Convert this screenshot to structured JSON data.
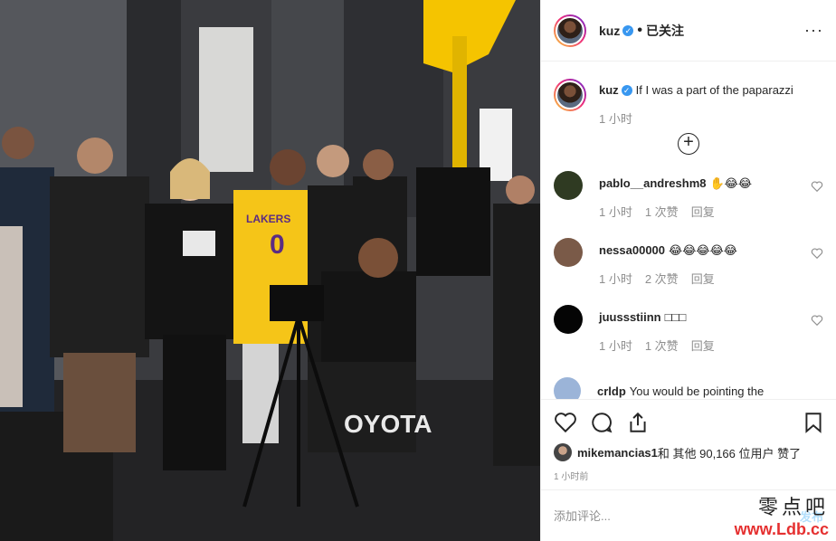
{
  "header": {
    "username": "kuz",
    "separator": "•",
    "follow_state": "已关注",
    "more": "···"
  },
  "caption": {
    "username": "kuz",
    "text": "If I was a part of the paparazzi",
    "time": "1 小时"
  },
  "comments": [
    {
      "username": "pablo__andreshm8",
      "text": "✋😂😂",
      "time": "1 小时",
      "likes": "1 次赞",
      "reply": "回复",
      "avatar_color": "#2f3a22"
    },
    {
      "username": "nessa00000",
      "text": "😂😂😂😂😂",
      "time": "1 小时",
      "likes": "2 次赞",
      "reply": "回复",
      "avatar_color": "#7a5a48"
    },
    {
      "username": "juussstiinn",
      "text": "□□□",
      "time": "1 小时",
      "likes": "1 次赞",
      "reply": "回复",
      "avatar_color": "#050505"
    }
  ],
  "partial_comment": {
    "username": "crldp",
    "text": "You would be pointing the"
  },
  "likes_line": {
    "user": "mikemancias1",
    "rest": " 和 其他 90,166 位用户 赞了"
  },
  "time_ago": "1 小时前",
  "add_comment": {
    "placeholder": "添加评论...",
    "post": "发布"
  },
  "watermark": {
    "cn": "零点吧",
    "url": "www.Ldb.cc"
  },
  "photo": {
    "jersey_team": "LAKERS",
    "jersey_number": "0",
    "banner_text": "OYOTA"
  },
  "colors": {
    "verified": "#3897f0",
    "jersey": "#f5c518",
    "watermark_url": "#e53030"
  }
}
